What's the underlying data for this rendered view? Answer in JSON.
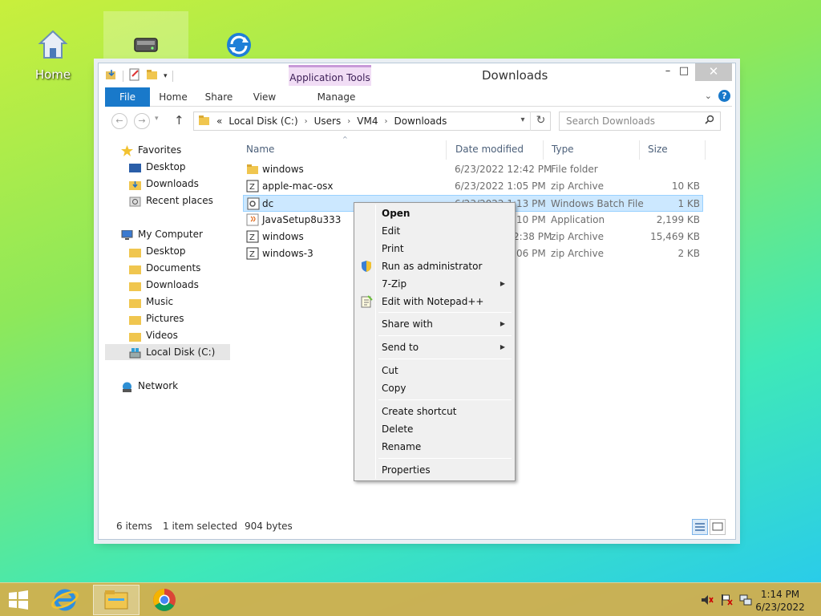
{
  "desktop": {
    "icons": [
      {
        "label": "Home"
      },
      {
        "label": ""
      },
      {
        "label": ""
      }
    ]
  },
  "window": {
    "title": "Downloads",
    "contextual_tab": "Application Tools",
    "ribbon_tabs": [
      "File",
      "Home",
      "Share",
      "View",
      "Manage"
    ],
    "controls": {
      "minimize": "–",
      "maximize": "□",
      "close": "✕"
    }
  },
  "address": {
    "overflow": "«",
    "crumbs": [
      "Local Disk (C:)",
      "Users",
      "VM4",
      "Downloads"
    ],
    "search_placeholder": "Search Downloads"
  },
  "nav": {
    "favorites": {
      "label": "Favorites",
      "items": [
        "Desktop",
        "Downloads",
        "Recent places"
      ]
    },
    "computer": {
      "label": "My Computer",
      "items": [
        "Desktop",
        "Documents",
        "Downloads",
        "Music",
        "Pictures",
        "Videos",
        "Local Disk (C:)"
      ]
    },
    "network": "Network"
  },
  "columns": [
    "Name",
    "Date modified",
    "Type",
    "Size"
  ],
  "files": [
    {
      "name": "windows",
      "date": "6/23/2022 12:42 PM",
      "type": "File folder",
      "size": "",
      "icon": "folder-icon"
    },
    {
      "name": "apple-mac-osx",
      "date": "6/23/2022 1:05 PM",
      "type": "zip Archive",
      "size": "10 KB",
      "icon": "zip-icon"
    },
    {
      "name": "dc",
      "date": "6/23/2022 1:13 PM",
      "type": "Windows Batch File",
      "size": "1 KB",
      "icon": "batch-file-icon"
    },
    {
      "name": "JavaSetup8u333",
      "date": "6/23/2022 1:10 PM",
      "type": "Application",
      "size": "2,199 KB",
      "icon": "java-installer-icon"
    },
    {
      "name": "windows",
      "date": "6/23/2022 12:38 PM",
      "type": "zip Archive",
      "size": "15,469 KB",
      "icon": "zip-icon"
    },
    {
      "name": "windows-3",
      "date": "6/23/2022 1:06 PM",
      "type": "zip Archive",
      "size": "2 KB",
      "icon": "zip-icon"
    }
  ],
  "status": {
    "items": "6 items",
    "selected": "1 item selected",
    "size": "904 bytes"
  },
  "context_menu": {
    "open": "Open",
    "edit": "Edit",
    "print": "Print",
    "run_as_admin": "Run as administrator",
    "seven_zip": "7-Zip",
    "edit_notepadpp": "Edit with Notepad++",
    "share_with": "Share with",
    "send_to": "Send to",
    "cut": "Cut",
    "copy": "Copy",
    "create_shortcut": "Create shortcut",
    "delete": "Delete",
    "rename": "Rename",
    "properties": "Properties"
  },
  "taskbar": {
    "time": "1:14 PM",
    "date": "6/23/2022"
  },
  "colors": {
    "accent": "#1979ca",
    "selection": "#cce8ff",
    "taskbar": "#d6ae4a"
  }
}
